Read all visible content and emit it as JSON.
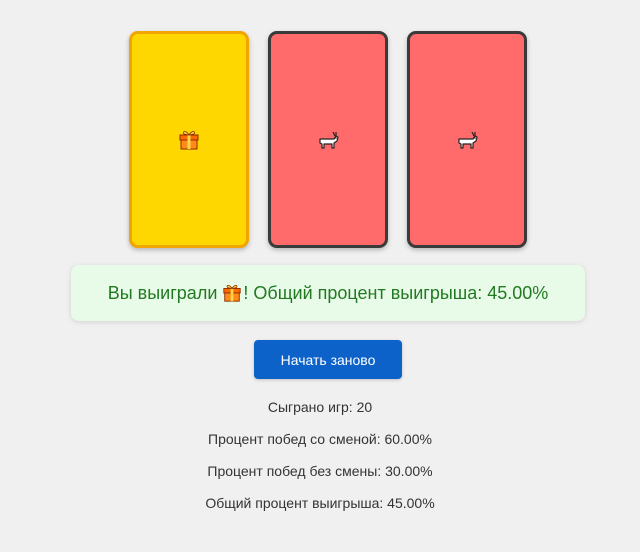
{
  "doors": [
    {
      "icon": "gift-icon",
      "emoji": "🎁",
      "state": "selected",
      "color": "#ffd700"
    },
    {
      "icon": "goat-icon",
      "emoji": "🐐",
      "state": "opened",
      "color": "#ff6b6b"
    },
    {
      "icon": "goat-icon",
      "emoji": "🐐",
      "state": "opened",
      "color": "#ff6b6b"
    }
  ],
  "result": {
    "prefix": "Вы выиграли",
    "prize_icon": "gift-icon",
    "suffix": "! Общий процент выигрыша: 45.00%"
  },
  "restart_button": {
    "label": "Начать заново",
    "color": "#0d62c9"
  },
  "stats": {
    "games_played": "Сыграно игр: 20",
    "switch_win_rate": "Процент побед со сменой: 60.00%",
    "stay_win_rate": "Процент побед без смены: 30.00%",
    "overall_win_rate": "Общий процент выигрыша: 45.00%"
  }
}
